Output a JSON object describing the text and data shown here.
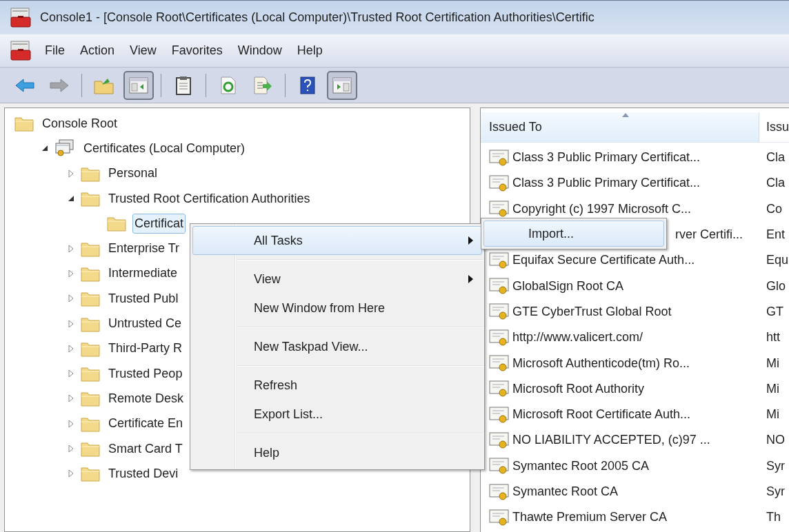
{
  "window": {
    "title": "Console1 - [Console Root\\Certificates (Local Computer)\\Trusted Root Certification Authorities\\Certific"
  },
  "menu_bar": [
    "File",
    "Action",
    "View",
    "Favorites",
    "Window",
    "Help"
  ],
  "toolbar": [
    {
      "kind": "back",
      "disabled": false,
      "pressed": false
    },
    {
      "kind": "forward",
      "disabled": true,
      "pressed": false
    },
    {
      "kind": "separator"
    },
    {
      "kind": "up",
      "disabled": false,
      "pressed": false
    },
    {
      "kind": "tree",
      "disabled": false,
      "pressed": true
    },
    {
      "kind": "separator"
    },
    {
      "kind": "properties",
      "disabled": false,
      "pressed": false
    },
    {
      "kind": "separator"
    },
    {
      "kind": "refresh",
      "disabled": false,
      "pressed": false
    },
    {
      "kind": "export",
      "disabled": false,
      "pressed": false
    },
    {
      "kind": "separator"
    },
    {
      "kind": "help",
      "disabled": false,
      "pressed": false
    },
    {
      "kind": "action",
      "disabled": false,
      "pressed": true
    }
  ],
  "tree": [
    {
      "label": "Console Root",
      "kind": "folder",
      "selected": false,
      "children": [
        {
          "label": "Certificates (Local Computer)",
          "kind": "store",
          "expanded": true,
          "selected": false,
          "children": [
            {
              "label": "Personal",
              "kind": "folder",
              "expanded": false,
              "selected": false
            },
            {
              "label": "Trusted Root Certification Authorities",
              "kind": "folder",
              "expanded": true,
              "selected": false,
              "children": [
                {
                  "label": "Certificat",
                  "kind": "folder",
                  "selected": true
                }
              ]
            },
            {
              "label": "Enterprise Tr",
              "kind": "folder",
              "expanded": false,
              "selected": false
            },
            {
              "label": "Intermediate",
              "kind": "folder",
              "expanded": false,
              "selected": false
            },
            {
              "label": "Trusted Publ",
              "kind": "folder",
              "expanded": false,
              "selected": false
            },
            {
              "label": "Untrusted Ce",
              "kind": "folder",
              "expanded": false,
              "selected": false
            },
            {
              "label": "Third-Party R",
              "kind": "folder",
              "expanded": false,
              "selected": false
            },
            {
              "label": "Trusted Peop",
              "kind": "folder",
              "expanded": false,
              "selected": false
            },
            {
              "label": "Remote Desk",
              "kind": "folder",
              "expanded": false,
              "selected": false
            },
            {
              "label": "Certificate En",
              "kind": "folder",
              "expanded": false,
              "selected": false
            },
            {
              "label": "Smart Card T",
              "kind": "folder",
              "expanded": false,
              "selected": false
            },
            {
              "label": "Trusted Devi",
              "kind": "folder",
              "expanded": false,
              "selected": false
            }
          ]
        }
      ]
    }
  ],
  "list": {
    "columns": [
      "Issued To",
      "Issu"
    ],
    "rows": [
      {
        "kind": "full",
        "cells": [
          "Class 3 Public Primary Certificat...",
          "Cla"
        ]
      },
      {
        "kind": "full",
        "cells": [
          "Class 3 Public Primary Certificat...",
          "Cla"
        ]
      },
      {
        "kind": "full",
        "cells": [
          "Copyright (c) 1997 Microsoft C...",
          "Co"
        ]
      },
      {
        "kind": "covered",
        "cells": [
          "rver Certifi...",
          "Ent"
        ]
      },
      {
        "kind": "full",
        "cells": [
          "Equifax Secure Certificate Auth...",
          "Equ"
        ]
      },
      {
        "kind": "full",
        "cells": [
          "GlobalSign Root CA",
          "Glo"
        ]
      },
      {
        "kind": "full",
        "cells": [
          "GTE CyberTrust Global Root",
          "GT"
        ]
      },
      {
        "kind": "full",
        "cells": [
          "http://www.valicert.com/",
          "htt"
        ]
      },
      {
        "kind": "full",
        "cells": [
          "Microsoft Authenticode(tm) Ro...",
          "Mi"
        ]
      },
      {
        "kind": "full",
        "cells": [
          "Microsoft Root Authority",
          "Mi"
        ]
      },
      {
        "kind": "full",
        "cells": [
          "Microsoft Root Certificate Auth...",
          "Mi"
        ]
      },
      {
        "kind": "full",
        "cells": [
          "NO LIABILITY ACCEPTED, (c)97 ...",
          "NO"
        ]
      },
      {
        "kind": "full",
        "cells": [
          "Symantec Root 2005 CA",
          "Syr"
        ]
      },
      {
        "kind": "full",
        "cells": [
          "Symantec Root CA",
          "Syr"
        ]
      },
      {
        "kind": "full",
        "cells": [
          "Thawte Premium Server CA",
          "Th"
        ]
      }
    ]
  },
  "context_menu": {
    "items": [
      {
        "kind": "item",
        "label": "All Tasks",
        "submenu": true,
        "selected": true
      },
      {
        "kind": "separator"
      },
      {
        "kind": "item",
        "label": "View",
        "submenu": true,
        "selected": false
      },
      {
        "kind": "item",
        "label": "New Window from Here",
        "submenu": false,
        "selected": false
      },
      {
        "kind": "separator"
      },
      {
        "kind": "item",
        "label": "New Taskpad View...",
        "submenu": false,
        "selected": false
      },
      {
        "kind": "separator"
      },
      {
        "kind": "item",
        "label": "Refresh",
        "submenu": false,
        "selected": false
      },
      {
        "kind": "item",
        "label": "Export List...",
        "submenu": false,
        "selected": false
      },
      {
        "kind": "separator"
      },
      {
        "kind": "item",
        "label": "Help",
        "submenu": false,
        "selected": false
      }
    ]
  },
  "submenu": {
    "items": [
      {
        "label": "Import...",
        "selected": true
      }
    ]
  }
}
